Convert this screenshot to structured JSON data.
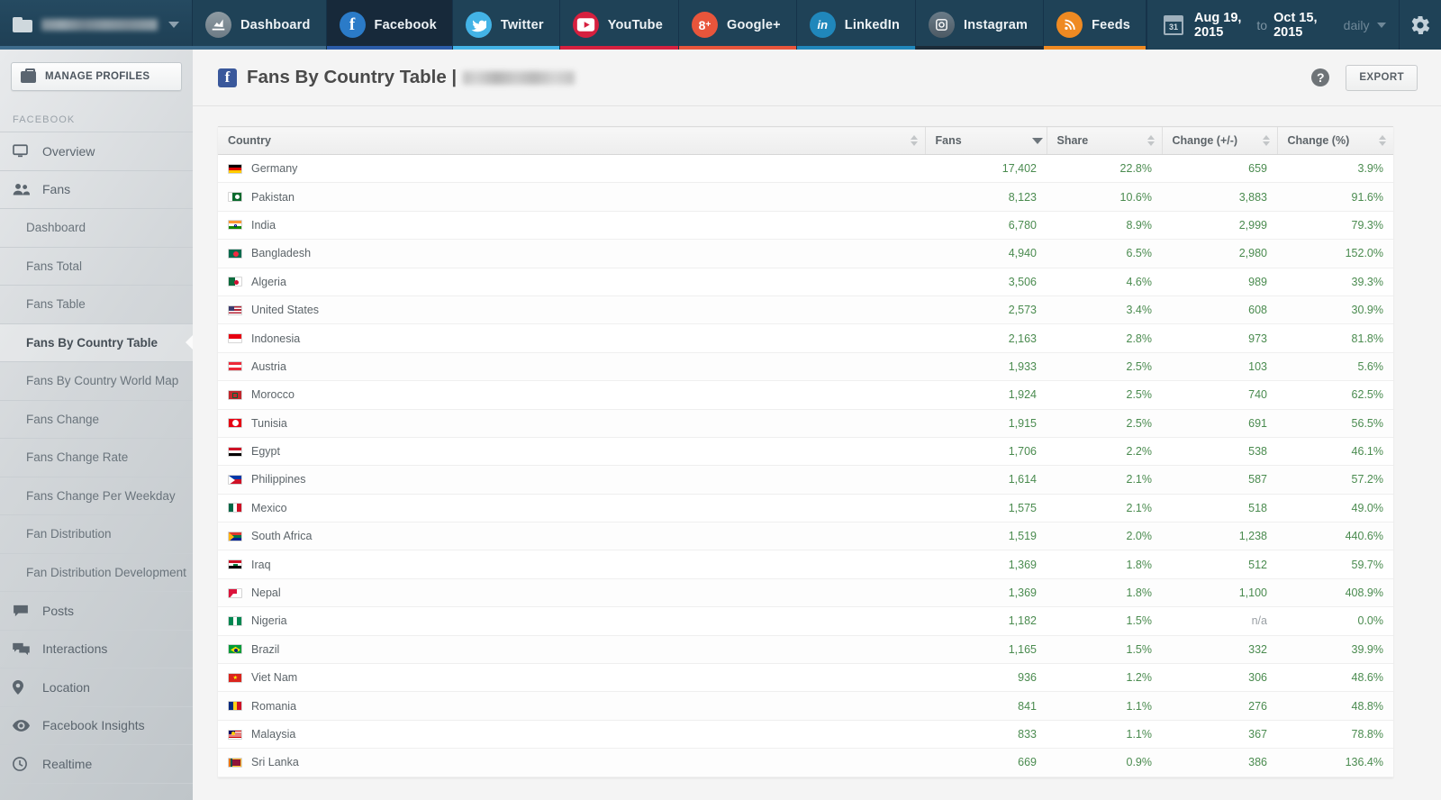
{
  "topbar": {
    "profile_selector": {
      "icon": "folder-icon",
      "name_blurred": true,
      "chevron": "chevron-down-icon"
    },
    "tabs": [
      {
        "label": "Dashboard",
        "icon": "chart-icon",
        "underline": "#3e6c8c",
        "active": false
      },
      {
        "label": "Facebook",
        "icon": "facebook-icon",
        "underline": "#2b5ca8",
        "active": true
      },
      {
        "label": "Twitter",
        "icon": "twitter-icon",
        "underline": "#43b3e6",
        "active": false
      },
      {
        "label": "YouTube",
        "icon": "youtube-icon",
        "underline": "#d6203f",
        "active": false
      },
      {
        "label": "Google+",
        "icon": "googleplus-icon",
        "underline": "#e8553b",
        "active": false
      },
      {
        "label": "LinkedIn",
        "icon": "linkedin-icon",
        "underline": "#2087bb",
        "active": false
      },
      {
        "label": "Instagram",
        "icon": "instagram-icon",
        "underline": "#1b2b38",
        "active": false
      },
      {
        "label": "Feeds",
        "icon": "rss-icon",
        "underline": "#ef8a22",
        "active": false
      }
    ],
    "date_range": {
      "calendar_icon": "calendar-icon",
      "calendar_day": "31",
      "start": "Aug 19, 2015",
      "separator": "to",
      "end": "Oct 15, 2015",
      "granularity": "daily",
      "chevron": "chevron-down-icon"
    },
    "settings_icon": "gear-icon"
  },
  "sidebar": {
    "manage_profiles": {
      "label": "MANAGE PROFILES",
      "icon": "briefcase-icon"
    },
    "section_label": "FACEBOOK",
    "items": [
      {
        "label": "Overview",
        "icon": "monitor-icon",
        "sub": false,
        "active": false
      },
      {
        "label": "Fans",
        "icon": "users-icon",
        "sub": false,
        "active": false
      },
      {
        "label": "Dashboard",
        "icon": "",
        "sub": true,
        "active": false
      },
      {
        "label": "Fans Total",
        "icon": "",
        "sub": true,
        "active": false
      },
      {
        "label": "Fans Table",
        "icon": "",
        "sub": true,
        "active": false
      },
      {
        "label": "Fans By Country Table",
        "icon": "",
        "sub": true,
        "active": true
      },
      {
        "label": "Fans By Country World Map",
        "icon": "",
        "sub": true,
        "active": false
      },
      {
        "label": "Fans Change",
        "icon": "",
        "sub": true,
        "active": false
      },
      {
        "label": "Fans Change Rate",
        "icon": "",
        "sub": true,
        "active": false
      },
      {
        "label": "Fans Change Per Weekday",
        "icon": "",
        "sub": true,
        "active": false
      },
      {
        "label": "Fan Distribution",
        "icon": "",
        "sub": true,
        "active": false
      },
      {
        "label": "Fan Distribution Development",
        "icon": "",
        "sub": true,
        "active": false
      },
      {
        "label": "Posts",
        "icon": "comment-icon",
        "sub": false,
        "active": false
      },
      {
        "label": "Interactions",
        "icon": "comments-icon",
        "sub": false,
        "active": false
      },
      {
        "label": "Location",
        "icon": "map-pin-icon",
        "sub": false,
        "active": false
      },
      {
        "label": "Facebook Insights",
        "icon": "eye-icon",
        "sub": false,
        "active": false
      },
      {
        "label": "Realtime",
        "icon": "clock-icon",
        "sub": false,
        "active": false
      }
    ]
  },
  "page": {
    "platform_icon": "facebook-icon",
    "title": "Fans By Country Table |",
    "title_suffix_blurred": true,
    "help_label": "?",
    "export_label": "EXPORT"
  },
  "table": {
    "columns": [
      {
        "label": "Country",
        "align": "left",
        "sorted": false
      },
      {
        "label": "Fans",
        "align": "right",
        "sorted": true,
        "direction": "desc"
      },
      {
        "label": "Share",
        "align": "right",
        "sorted": false
      },
      {
        "label": "Change (+/-)",
        "align": "right",
        "sorted": false
      },
      {
        "label": "Change (%)",
        "align": "right",
        "sorted": false
      }
    ],
    "rows": [
      {
        "country": "Germany",
        "flag": "de",
        "fans": "17,402",
        "share": "22.8%",
        "change_abs": "659",
        "change_pct": "3.9%"
      },
      {
        "country": "Pakistan",
        "flag": "pk",
        "fans": "8,123",
        "share": "10.6%",
        "change_abs": "3,883",
        "change_pct": "91.6%"
      },
      {
        "country": "India",
        "flag": "in",
        "fans": "6,780",
        "share": "8.9%",
        "change_abs": "2,999",
        "change_pct": "79.3%"
      },
      {
        "country": "Bangladesh",
        "flag": "bd",
        "fans": "4,940",
        "share": "6.5%",
        "change_abs": "2,980",
        "change_pct": "152.0%"
      },
      {
        "country": "Algeria",
        "flag": "dz",
        "fans": "3,506",
        "share": "4.6%",
        "change_abs": "989",
        "change_pct": "39.3%"
      },
      {
        "country": "United States",
        "flag": "us",
        "fans": "2,573",
        "share": "3.4%",
        "change_abs": "608",
        "change_pct": "30.9%"
      },
      {
        "country": "Indonesia",
        "flag": "id",
        "fans": "2,163",
        "share": "2.8%",
        "change_abs": "973",
        "change_pct": "81.8%"
      },
      {
        "country": "Austria",
        "flag": "at",
        "fans": "1,933",
        "share": "2.5%",
        "change_abs": "103",
        "change_pct": "5.6%"
      },
      {
        "country": "Morocco",
        "flag": "ma",
        "fans": "1,924",
        "share": "2.5%",
        "change_abs": "740",
        "change_pct": "62.5%"
      },
      {
        "country": "Tunisia",
        "flag": "tn",
        "fans": "1,915",
        "share": "2.5%",
        "change_abs": "691",
        "change_pct": "56.5%"
      },
      {
        "country": "Egypt",
        "flag": "eg",
        "fans": "1,706",
        "share": "2.2%",
        "change_abs": "538",
        "change_pct": "46.1%"
      },
      {
        "country": "Philippines",
        "flag": "ph",
        "fans": "1,614",
        "share": "2.1%",
        "change_abs": "587",
        "change_pct": "57.2%"
      },
      {
        "country": "Mexico",
        "flag": "mx",
        "fans": "1,575",
        "share": "2.1%",
        "change_abs": "518",
        "change_pct": "49.0%"
      },
      {
        "country": "South Africa",
        "flag": "za",
        "fans": "1,519",
        "share": "2.0%",
        "change_abs": "1,238",
        "change_pct": "440.6%"
      },
      {
        "country": "Iraq",
        "flag": "iq",
        "fans": "1,369",
        "share": "1.8%",
        "change_abs": "512",
        "change_pct": "59.7%"
      },
      {
        "country": "Nepal",
        "flag": "np",
        "fans": "1,369",
        "share": "1.8%",
        "change_abs": "1,100",
        "change_pct": "408.9%"
      },
      {
        "country": "Nigeria",
        "flag": "ng",
        "fans": "1,182",
        "share": "1.5%",
        "change_abs": "n/a",
        "change_pct": "0.0%"
      },
      {
        "country": "Brazil",
        "flag": "br",
        "fans": "1,165",
        "share": "1.5%",
        "change_abs": "332",
        "change_pct": "39.9%"
      },
      {
        "country": "Viet Nam",
        "flag": "vn",
        "fans": "936",
        "share": "1.2%",
        "change_abs": "306",
        "change_pct": "48.6%"
      },
      {
        "country": "Romania",
        "flag": "ro",
        "fans": "841",
        "share": "1.1%",
        "change_abs": "276",
        "change_pct": "48.8%"
      },
      {
        "country": "Malaysia",
        "flag": "my",
        "fans": "833",
        "share": "1.1%",
        "change_abs": "367",
        "change_pct": "78.8%"
      },
      {
        "country": "Sri Lanka",
        "flag": "lk",
        "fans": "669",
        "share": "0.9%",
        "change_abs": "386",
        "change_pct": "136.4%"
      }
    ]
  },
  "colors": {
    "topbar_bg": "#1f4257",
    "positive_value": "#4a8b4f",
    "na_value": "#9aa0a5",
    "facebook_blue": "#3a589b"
  }
}
